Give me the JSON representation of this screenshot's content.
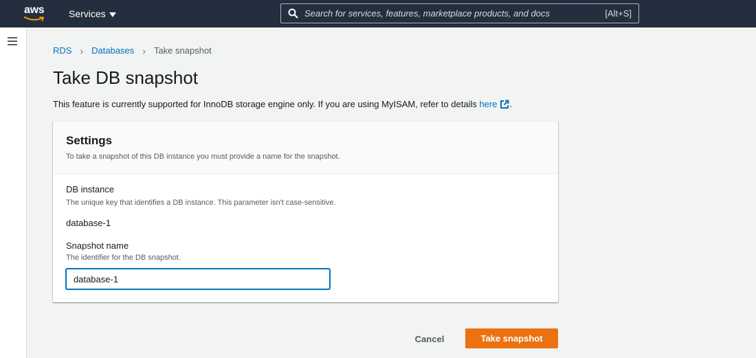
{
  "nav": {
    "logo_text": "aws",
    "services_label": "Services",
    "search_placeholder": "Search for services, features, marketplace products, and docs",
    "search_shortcut": "[Alt+S]"
  },
  "breadcrumb": {
    "items": [
      "RDS",
      "Databases"
    ],
    "current": "Take snapshot"
  },
  "page": {
    "title": "Take DB snapshot",
    "notice_text": "This feature is currently supported for InnoDB storage engine only. If you are using MyISAM, refer to details ",
    "notice_link": "here",
    "notice_end": "."
  },
  "settings": {
    "title": "Settings",
    "description": "To take a snapshot of this DB instance you must provide a name for the snapshot.",
    "db_instance_label": "DB instance",
    "db_instance_desc": "The unique key that identifies a DB instance. This parameter isn't case-sensitive.",
    "db_instance_value": "database-1",
    "snapshot_name_label": "Snapshot name",
    "snapshot_name_desc": "The identifier for the DB snapshot.",
    "snapshot_name_value": "database-1"
  },
  "actions": {
    "cancel_label": "Cancel",
    "submit_label": "Take snapshot"
  },
  "colors": {
    "nav_bg": "#232f3e",
    "link": "#0073bb",
    "primary": "#ec7211",
    "page_bg": "#f2f3f3"
  }
}
